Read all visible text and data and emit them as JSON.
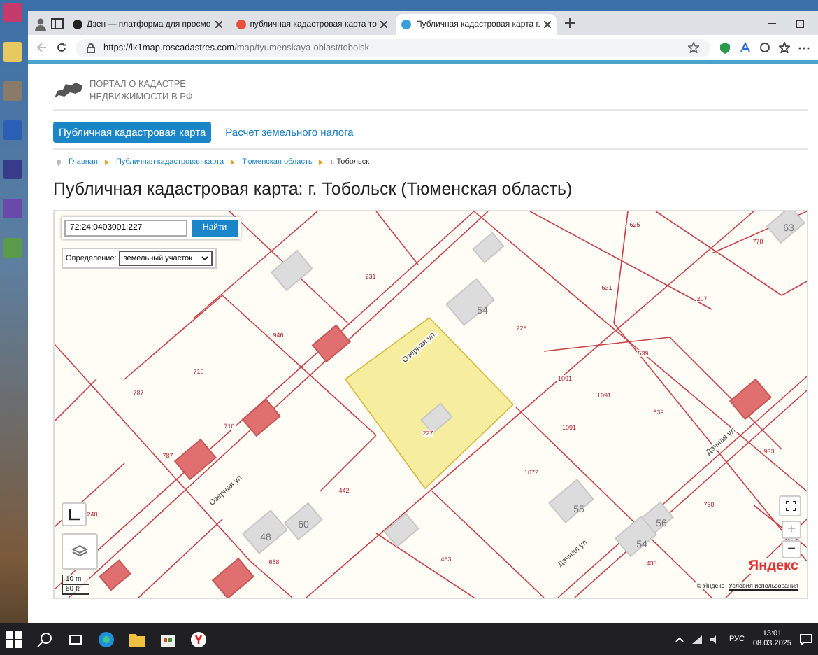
{
  "browser": {
    "tabs": [
      {
        "title": "Дзен — платформа для просмо",
        "selected": false,
        "kind": "dzen"
      },
      {
        "title": "публичная кадастровая карта то",
        "selected": false,
        "kind": "yandex"
      },
      {
        "title": "Публичная кадастровая карта г.",
        "selected": true,
        "kind": "site"
      }
    ],
    "url_host": "https://lk1map.roscadastres.com",
    "url_path": "/map/tyumenskaya-oblast/tobolsk"
  },
  "site": {
    "logo_lines": [
      "ПОРТАЛ О КАДАСТРЕ",
      "НЕДВИЖИМОСТИ В РФ"
    ],
    "nav": [
      {
        "label": "Публичная кадастровая карта",
        "selected": true
      },
      {
        "label": "Расчет земельного налога",
        "selected": false
      }
    ],
    "breadcrumbs": [
      "Главная",
      "Публичная кадастровая карта",
      "Тюменская область",
      "г. Тобольск"
    ],
    "title": "Публичная кадастровая карта: г. Тобольск (Тюменская область)"
  },
  "map": {
    "search_value": "72:24:0403001:227",
    "search_button": "Найти",
    "mode_label": "Определение:",
    "mode_value": "земельный участок",
    "labels": [
      {
        "text": "231",
        "kind": "parcel"
      },
      {
        "text": "946",
        "kind": "parcel"
      },
      {
        "text": "710",
        "kind": "parcel"
      },
      {
        "text": "787",
        "kind": "parcel"
      },
      {
        "text": "710",
        "kind": "parcel"
      },
      {
        "text": "787",
        "kind": "parcel"
      },
      {
        "text": "442",
        "kind": "parcel"
      },
      {
        "text": "240",
        "kind": "parcel"
      },
      {
        "text": "658",
        "kind": "parcel"
      },
      {
        "text": "483",
        "kind": "parcel"
      },
      {
        "text": "1072",
        "kind": "parcel"
      },
      {
        "text": "1091",
        "kind": "parcel"
      },
      {
        "text": "1091",
        "kind": "parcel"
      },
      {
        "text": "1091",
        "kind": "parcel"
      },
      {
        "text": "539",
        "kind": "parcel"
      },
      {
        "text": "539",
        "kind": "parcel"
      },
      {
        "text": "207",
        "kind": "parcel"
      },
      {
        "text": "778",
        "kind": "parcel"
      },
      {
        "text": "625",
        "kind": "parcel"
      },
      {
        "text": "631",
        "kind": "parcel"
      },
      {
        "text": "228",
        "kind": "parcel"
      },
      {
        "text": "438",
        "kind": "parcel"
      },
      {
        "text": "750",
        "kind": "parcel"
      },
      {
        "text": "933",
        "kind": "parcel"
      },
      {
        "text": "227",
        "kind": "parcel"
      },
      {
        "text": "54",
        "kind": "building"
      },
      {
        "text": "48",
        "kind": "building"
      },
      {
        "text": "60",
        "kind": "building"
      },
      {
        "text": "55",
        "kind": "building"
      },
      {
        "text": "56",
        "kind": "building"
      },
      {
        "text": "54",
        "kind": "building"
      },
      {
        "text": "63",
        "kind": "building"
      },
      {
        "text": "Озерная ул.",
        "kind": "street"
      },
      {
        "text": "Озерная ул.",
        "kind": "street"
      },
      {
        "text": "Дачная ул.",
        "kind": "street"
      },
      {
        "text": "Дачная ул.",
        "kind": "street"
      }
    ],
    "scale": [
      "10 m",
      "50 ft"
    ],
    "zoom_in": "+",
    "zoom_out": "−",
    "copyright": "© Яндекс",
    "terms": "Условия использования",
    "brand": "Яндекс"
  },
  "taskbar": {
    "language": "РУС",
    "time": "13:01",
    "date": "08.03.2025"
  }
}
